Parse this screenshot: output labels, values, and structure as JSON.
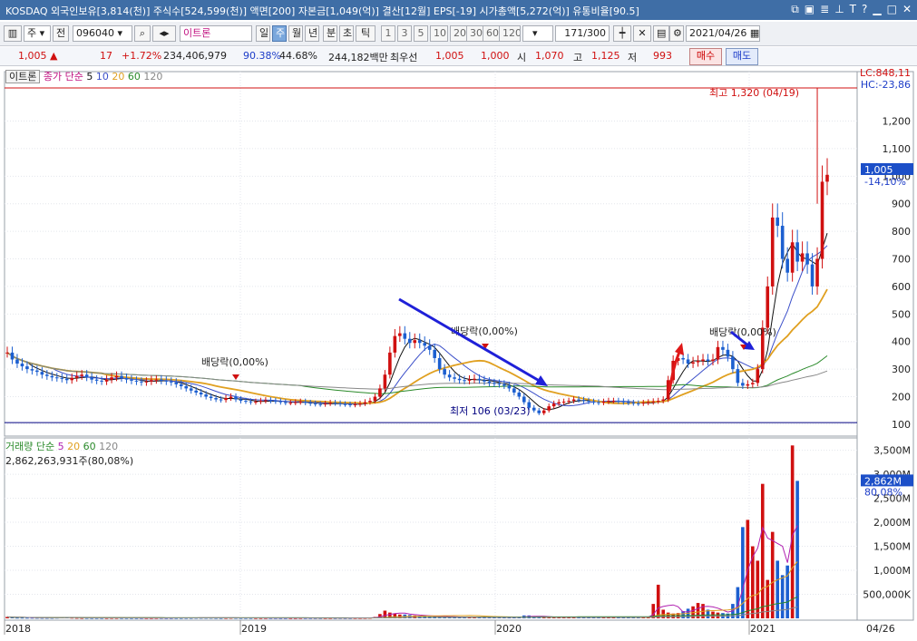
{
  "title_bar": {
    "text": "KOSDAQ 외국인보유[3,814(천)] 주식수[524,599(천)] 액면[200] 자본금[1,049(억)] 결산[12월] EPS[-19] 시가총액[5,272(억)] 유통비율[90.5]",
    "icons": [
      "window-icon",
      "split-icon",
      "list-icon",
      "tool-icon",
      "text-icon",
      "help-icon",
      "minimize-icon",
      "maximize-icon",
      "close-icon"
    ]
  },
  "toolbar": {
    "period_type": "주",
    "prev_label": "전",
    "code": "096040",
    "stock_name": "이트론",
    "period_buttons": [
      "일",
      "주",
      "월",
      "년",
      "분",
      "초",
      "틱"
    ],
    "active_period": "주",
    "interval_buttons": [
      "1",
      "3",
      "5",
      "10",
      "20",
      "30",
      "60",
      "120"
    ],
    "count": "171",
    "count_total": "/300",
    "date": "2021/04/26"
  },
  "price_bar": {
    "price": "1,005",
    "change": "17",
    "change_pct": "+1.72%",
    "volume": "234,406,979",
    "ratio1": "90.38%",
    "ratio2": "44.68%",
    "amount": "244,182백만",
    "best_label": "최우선",
    "best_ask": "1,005",
    "best_bid": "1,000",
    "open_label": "시",
    "open": "1,070",
    "high_label": "고",
    "high": "1,125",
    "low_label": "저",
    "low": "993",
    "buy_label": "매수",
    "sell_label": "매도"
  },
  "price_panel": {
    "stock_tag": "이트론",
    "legend_main": "종가 단순",
    "ma_labels": [
      "5",
      "10",
      "20",
      "60",
      "120"
    ],
    "ma_colors": [
      "#111111",
      "#3b4fc9",
      "#e0a020",
      "#2a8a2a",
      "#888888"
    ],
    "lc_label": "LC:848,11",
    "hc_label": "HC:-23,86",
    "current_price_tag": "1,005",
    "current_pct_tag": "-14,10%",
    "high_annotation": "최고 1,320 (04/19)",
    "low_annotation": "최저 106 (03/23)",
    "dividend_labels": [
      "배당락(0,00%)",
      "배당락(0,00%)",
      "배당락(0,00%)"
    ],
    "y_ticks": [
      "1,200",
      "1,100",
      "1,000",
      "900",
      "800",
      "700",
      "600",
      "500",
      "400",
      "300",
      "200",
      "100"
    ]
  },
  "volume_panel": {
    "legend": "거래량 단순",
    "ma_labels": [
      "5",
      "20",
      "60",
      "120"
    ],
    "ma_colors": [
      "#b020b0",
      "#e0a020",
      "#2a8a2a",
      "#888888"
    ],
    "total_text": "2,862,263,931주(80,08%)",
    "current_tag": "2,862M",
    "current_pct": "80,08%",
    "y_ticks": [
      "3,500M",
      "3,000M",
      "2,500M",
      "2,000M",
      "1,500M",
      "1,000M",
      "500,000K"
    ]
  },
  "x_axis": {
    "labels": [
      "2018",
      "2019",
      "2020",
      "2021"
    ],
    "right_label": "04/26"
  },
  "colors": {
    "up": "#d01010",
    "down": "#1c5fd0",
    "arrow_blue": "#1f20d8",
    "arrow_red": "#e01818",
    "title_bg": "#3f6ea6"
  },
  "chart_data": {
    "type": "candlestick",
    "interval": "weekly",
    "price_range": [
      80,
      1330
    ],
    "volume_range_millions": [
      0,
      3700
    ],
    "closes": [
      360,
      335,
      320,
      310,
      300,
      295,
      290,
      280,
      275,
      270,
      268,
      265,
      260,
      268,
      275,
      280,
      270,
      262,
      258,
      255,
      262,
      270,
      275,
      268,
      262,
      258,
      255,
      252,
      255,
      260,
      262,
      258,
      255,
      252,
      245,
      238,
      230,
      222,
      215,
      208,
      200,
      195,
      190,
      188,
      195,
      200,
      190,
      185,
      183,
      180,
      182,
      185,
      187,
      185,
      183,
      180,
      178,
      178,
      180,
      182,
      178,
      175,
      173,
      172,
      175,
      178,
      176,
      173,
      172,
      170,
      172,
      175,
      180,
      185,
      200,
      230,
      280,
      360,
      420,
      430,
      410,
      395,
      405,
      395,
      385,
      370,
      340,
      300,
      280,
      270,
      265,
      260,
      258,
      262,
      265,
      260,
      255,
      250,
      248,
      245,
      240,
      230,
      215,
      200,
      180,
      160,
      150,
      140,
      150,
      165,
      175,
      180,
      182,
      185,
      190,
      188,
      185,
      182,
      180,
      178,
      182,
      185,
      185,
      183,
      180,
      178,
      176,
      175,
      178,
      180,
      183,
      185,
      190,
      260,
      330,
      340,
      335,
      320,
      325,
      330,
      335,
      330,
      335,
      380,
      370,
      345,
      300,
      250,
      240,
      245,
      250,
      300,
      450,
      600,
      850,
      820,
      700,
      650,
      760,
      690,
      720,
      680,
      600,
      700,
      980,
      1005
    ],
    "volumes_millions": [
      30,
      20,
      15,
      15,
      14,
      14,
      13,
      12,
      12,
      12,
      15,
      20,
      25,
      15,
      12,
      10,
      10,
      9,
      9,
      9,
      9,
      10,
      10,
      9,
      9,
      8,
      8,
      8,
      8,
      8,
      9,
      9,
      8,
      8,
      9,
      9,
      10,
      10,
      12,
      12,
      12,
      12,
      10,
      9,
      10,
      12,
      11,
      9,
      9,
      9,
      8,
      8,
      8,
      8,
      8,
      7,
      7,
      7,
      7,
      8,
      8,
      8,
      7,
      7,
      7,
      7,
      7,
      8,
      7,
      7,
      8,
      8,
      9,
      12,
      30,
      90,
      160,
      120,
      100,
      80,
      80,
      70,
      60,
      50,
      50,
      40,
      40,
      35,
      30,
      30,
      25,
      22,
      22,
      22,
      24,
      22,
      20,
      20,
      20,
      20,
      20,
      18,
      22,
      30,
      60,
      60,
      40,
      30,
      25,
      22,
      22,
      22,
      22,
      22,
      22,
      22,
      20,
      20,
      20,
      20,
      20,
      20,
      20,
      20,
      20,
      20,
      22,
      22,
      25,
      30,
      300,
      700,
      180,
      120,
      100,
      110,
      150,
      200,
      250,
      320,
      300,
      180,
      140,
      120,
      110,
      100,
      300,
      650,
      1900,
      2050,
      1500,
      1200,
      2800,
      800,
      1800,
      1200,
      900,
      1100,
      3600,
      2862
    ]
  }
}
